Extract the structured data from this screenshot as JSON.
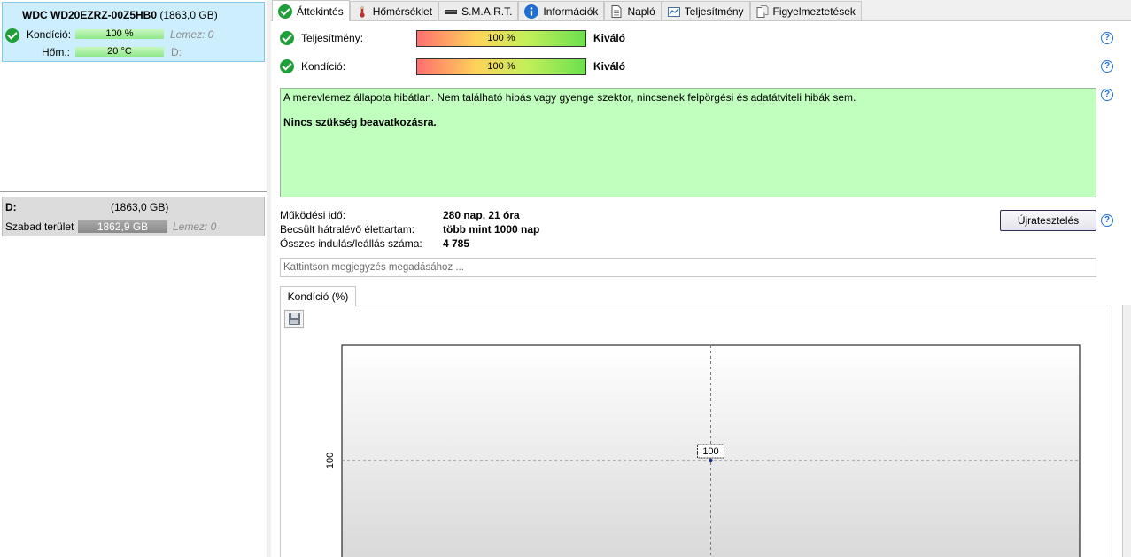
{
  "disk": {
    "name": "WDC WD20EZRZ-00Z5HB0",
    "size": "(1863,0 GB)",
    "condition_label": "Kondíció:",
    "condition_value": "100 %",
    "condition_fill": 1.0,
    "temp_label": "Hőm.:",
    "temp_value": "20 °C",
    "disk_label": "Lemez: 0",
    "drive_label": "D:"
  },
  "volume": {
    "drive": "D:",
    "size": "(1863,0 GB)",
    "free_label": "Szabad terület",
    "free_value": "1862,9 GB",
    "disk_label": "Lemez: 0"
  },
  "tabs": [
    {
      "label": "Áttekintés",
      "icon": "check-icon"
    },
    {
      "label": "Hőmérséklet",
      "icon": "thermometer-icon"
    },
    {
      "label": "S.M.A.R.T.",
      "icon": "smart-icon"
    },
    {
      "label": "Információk",
      "icon": "info-icon"
    },
    {
      "label": "Napló",
      "icon": "document-icon"
    },
    {
      "label": "Teljesítmény",
      "icon": "chart-icon"
    },
    {
      "label": "Figyelmeztetések",
      "icon": "alerts-icon"
    }
  ],
  "overview": {
    "performance_label": "Teljesítmény:",
    "performance_value": "100 %",
    "performance_fill": 1.0,
    "performance_rating": "Kiváló",
    "health_label": "Kondíció:",
    "health_value": "100 %",
    "health_fill": 1.0,
    "health_rating": "Kiváló",
    "message": "A merevlemez állapota hibátlan. Nem található hibás vagy gyenge szektor, nincsenek felpörgési és adatátviteli hibák sem.",
    "message_bold": "Nincs szükség beavatkozásra.",
    "uptime_label": "Működési idő:",
    "uptime_value": "280 nap, 21 óra",
    "lifetime_label": "Becsült hátralévő élettartam:",
    "lifetime_value": "több mint 1000 nap",
    "starts_label": "Összes indulás/leállás száma:",
    "starts_value": "4 785",
    "retest_button": "Újratesztelés",
    "note_placeholder": "Kattintson megjegyzés megadásához ...",
    "help_glyph": "?"
  },
  "chart_tab": "Kondíció  (%)",
  "chart_data": {
    "type": "line",
    "title": "",
    "xlabel": "",
    "ylabel": "",
    "series": [
      {
        "values": [
          100
        ]
      }
    ],
    "point_label": "100",
    "y_tick": "100",
    "ylim": [
      0,
      200
    ],
    "grid": true
  },
  "colors": {
    "selected_card": "#cdeefc",
    "ok_green": "#1f9e3a",
    "message_bg": "#c0ffbe",
    "help_blue": "#1e6ed4"
  }
}
